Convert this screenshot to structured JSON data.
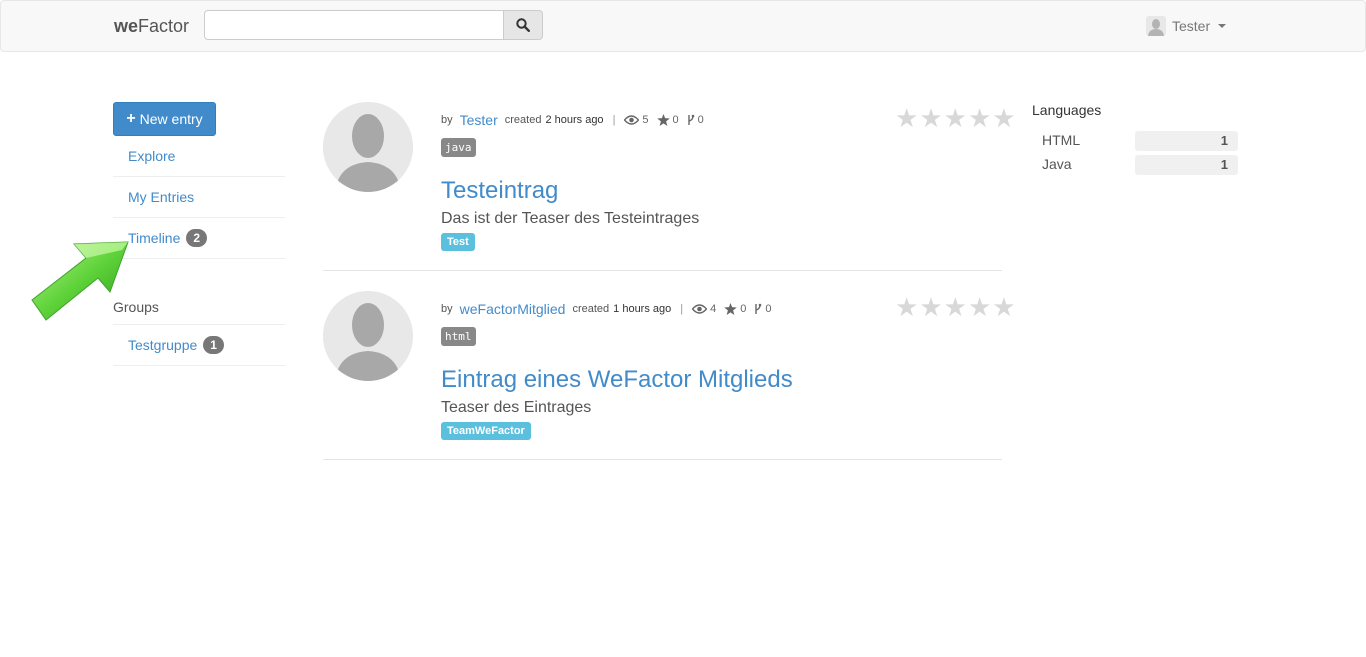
{
  "header": {
    "brand_bold": "we",
    "brand_rest": "Factor",
    "search_placeholder": "",
    "user_name": "Tester"
  },
  "sidebar": {
    "new_entry_label": "New entry",
    "nav": [
      {
        "label": "Explore"
      },
      {
        "label": "My Entries"
      },
      {
        "label": "Timeline",
        "badge": "2"
      }
    ],
    "groups_heading": "Groups",
    "groups": [
      {
        "label": "Testgruppe",
        "badge": "1"
      }
    ]
  },
  "entries": [
    {
      "by": "by",
      "author": "Tester",
      "created": "created",
      "time": "2 hours ago",
      "views": "5",
      "stars": "0",
      "forks": "0",
      "language": "java",
      "title": "Testeintrag",
      "teaser": "Das ist der Teaser des Testeintrages",
      "tag": "Test"
    },
    {
      "by": "by",
      "author": "weFactorMitglied",
      "created": "created",
      "time": "1 hours ago",
      "views": "4",
      "stars": "0",
      "forks": "0",
      "language": "html",
      "title": "Eintrag eines WeFactor Mitglieds",
      "teaser": "Teaser des Eintrages",
      "tag": "TeamWeFactor"
    }
  ],
  "languages": {
    "heading": "Languages",
    "items": [
      {
        "name": "HTML",
        "count": "1"
      },
      {
        "name": "Java",
        "count": "1"
      }
    ]
  },
  "colors": {
    "link": "#428bca",
    "primary_button": "#428bca",
    "tag_info": "#5bc0de",
    "badge": "#777777",
    "arrow": "#5fd33a"
  },
  "icons": [
    "search-icon",
    "user-avatar-icon",
    "plus-icon",
    "eye-icon",
    "star-icon",
    "fork-icon",
    "rating-star-icon",
    "green-arrow-icon"
  ]
}
